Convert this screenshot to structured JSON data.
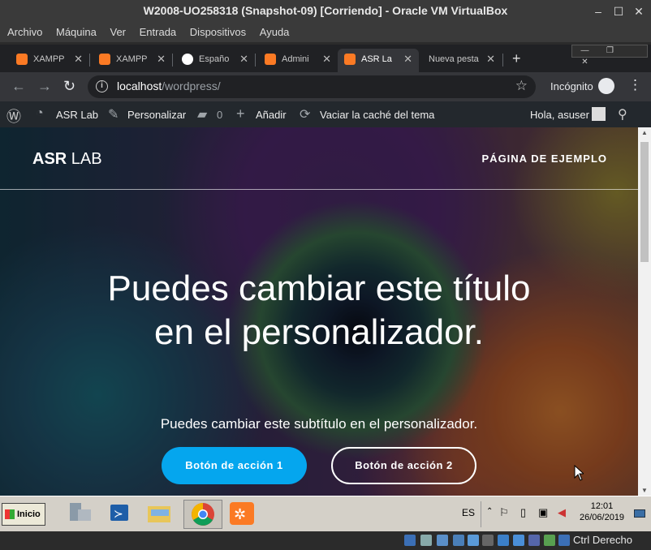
{
  "vbox": {
    "title": "W2008-UO258318 (Snapshot-09) [Corriendo] - Oracle VM VirtualBox",
    "menu": [
      "Archivo",
      "Máquina",
      "Ver",
      "Entrada",
      "Dispositivos",
      "Ayuda"
    ],
    "host_key": "Ctrl Derecho"
  },
  "browser": {
    "tabs": [
      {
        "label": "XAMPP",
        "icon": "xampp-icon"
      },
      {
        "label": "XAMPP",
        "icon": "xampp-icon"
      },
      {
        "label": "Españo",
        "icon": "wordpress-icon"
      },
      {
        "label": "Admini",
        "icon": "xampp-icon"
      },
      {
        "label": "ASR La",
        "icon": "xampp-icon",
        "active": true
      },
      {
        "label": "Nueva pesta",
        "icon": ""
      }
    ],
    "url_host": "localhost",
    "url_path": "/wordpress/",
    "incognito_label": "Incógnito"
  },
  "adminbar": {
    "site": "ASR Lab",
    "customize": "Personalizar",
    "comments": "0",
    "add": "Añadir",
    "purge": "Vaciar la caché del tema",
    "greeting": "Hola, asuser"
  },
  "site": {
    "title_bold": "ASR",
    "title_light": "LAB",
    "menu_item": "PÁGINA DE EJEMPLO",
    "hero_title": "Puedes cambiar este título en el personalizador.",
    "hero_subtitle": "Puedes cambiar este subtítulo en el personalizador.",
    "button1": "Botón de acción 1",
    "button2": "Botón de acción 2"
  },
  "taskbar": {
    "start": "Inicio",
    "lang": "ES",
    "time": "12:01",
    "date": "26/06/2019"
  },
  "colors": {
    "primary_button": "#05a6ee",
    "adminbar": "#23282d",
    "chrome_dark": "#202124"
  }
}
